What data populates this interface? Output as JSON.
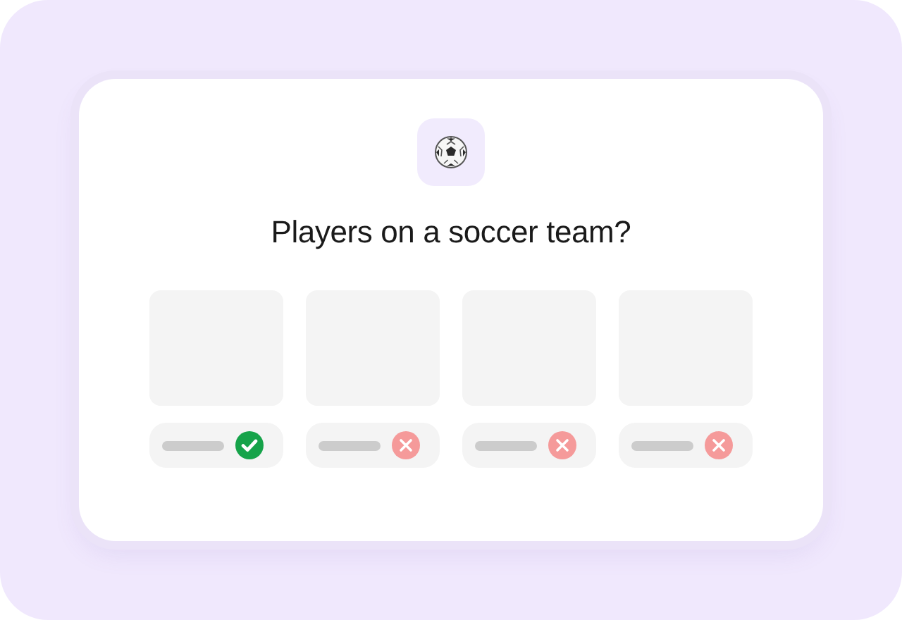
{
  "question": "Players on a soccer team?",
  "options": [
    {
      "correct": true
    },
    {
      "correct": false
    },
    {
      "correct": false
    },
    {
      "correct": false
    }
  ]
}
